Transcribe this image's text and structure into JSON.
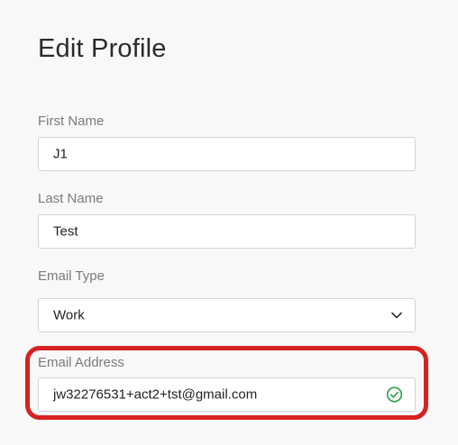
{
  "page": {
    "title": "Edit Profile"
  },
  "form": {
    "first_name": {
      "label": "First Name",
      "value": "J1"
    },
    "last_name": {
      "label": "Last Name",
      "value": "Test"
    },
    "email_type": {
      "label": "Email Type",
      "selected": "Work"
    },
    "email_address": {
      "label": "Email Address",
      "value": "jw32276531+act2+tst@gmail.com",
      "status": "valid"
    }
  },
  "icons": {
    "email_type_caret": "chevron-down-icon",
    "email_valid": "check-circle-icon"
  },
  "colors": {
    "highlight": "#d62222",
    "valid": "#2e9e4a"
  }
}
